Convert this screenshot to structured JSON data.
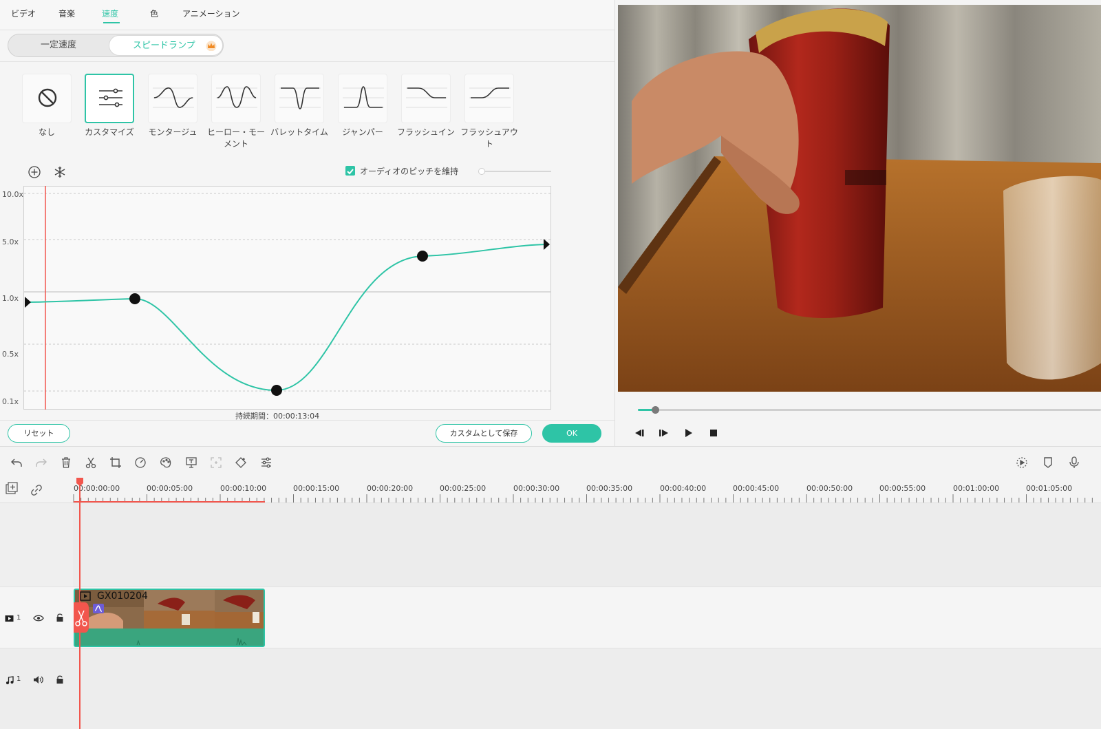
{
  "tabs": [
    {
      "label": "ビデオ",
      "active": false
    },
    {
      "label": "音楽",
      "active": false
    },
    {
      "label": "速度",
      "active": true
    },
    {
      "label": "色",
      "active": false
    },
    {
      "label": "アニメーション",
      "active": false
    }
  ],
  "speed_mode": {
    "constant_label": "一定速度",
    "ramp_label": "スピードランプ",
    "ramp_icon": "crown-icon",
    "selected": "ramp"
  },
  "presets": [
    {
      "label": "なし",
      "icon": "none-icon",
      "selected": false
    },
    {
      "label": "カスタマイズ",
      "icon": "sliders-icon",
      "selected": true
    },
    {
      "label": "モンタージュ",
      "icon": "montage-curve-icon",
      "selected": false
    },
    {
      "label": "ヒーロー・モーメント",
      "icon": "hero-moment-curve-icon",
      "selected": false
    },
    {
      "label": "バレットタイム",
      "icon": "bullet-time-curve-icon",
      "selected": false
    },
    {
      "label": "ジャンパー",
      "icon": "jumper-curve-icon",
      "selected": false
    },
    {
      "label": "フラッシュイン",
      "icon": "flash-in-curve-icon",
      "selected": false
    },
    {
      "label": "フラッシュアウト",
      "icon": "flash-out-curve-icon",
      "selected": false
    }
  ],
  "graph_tools": {
    "add_icon": "plus-circle-icon",
    "freeze_icon": "snowflake-icon"
  },
  "pitch": {
    "label": "オーディオのピッチを維持",
    "checked": true
  },
  "graph": {
    "y_labels": [
      "10.0x",
      "5.0x",
      "1.0x",
      "0.5x",
      "0.1x"
    ],
    "curve_color": "#2ec4a6",
    "playhead_color": "#f2564d",
    "duration_label": "持続期間：00:00:13:04"
  },
  "buttons": {
    "reset": "リセット",
    "save_custom": "カスタムとして保存",
    "ok": "OK"
  },
  "preview": {
    "controls": [
      "prev-frame-icon",
      "next-frame-icon",
      "play-icon",
      "stop-icon"
    ]
  },
  "toolbar_icons": [
    "undo-icon",
    "redo-icon",
    "trash-icon",
    "scissors-icon",
    "crop-icon",
    "speed-icon",
    "palette-icon",
    "text-icon",
    "zoom-fit-icon",
    "keyframe-icon",
    "adjust-icon",
    "render-icon",
    "marker-icon",
    "microphone-icon"
  ],
  "ruler": {
    "labels": [
      "00:00:00:00",
      "00:00:05:00",
      "00:00:10:00",
      "00:00:15:00",
      "00:00:20:00",
      "00:00:25:00",
      "00:00:30:00",
      "00:00:35:00",
      "00:00:40:00",
      "00:00:45:00",
      "00:00:50:00",
      "00:00:55:00",
      "00:01:00:00",
      "00:01:05:00"
    ]
  },
  "tracks": {
    "video": {
      "number": "1"
    },
    "audio": {
      "number": "1"
    }
  },
  "clip": {
    "name": "GX010204",
    "accent": "#2ec4a6"
  }
}
